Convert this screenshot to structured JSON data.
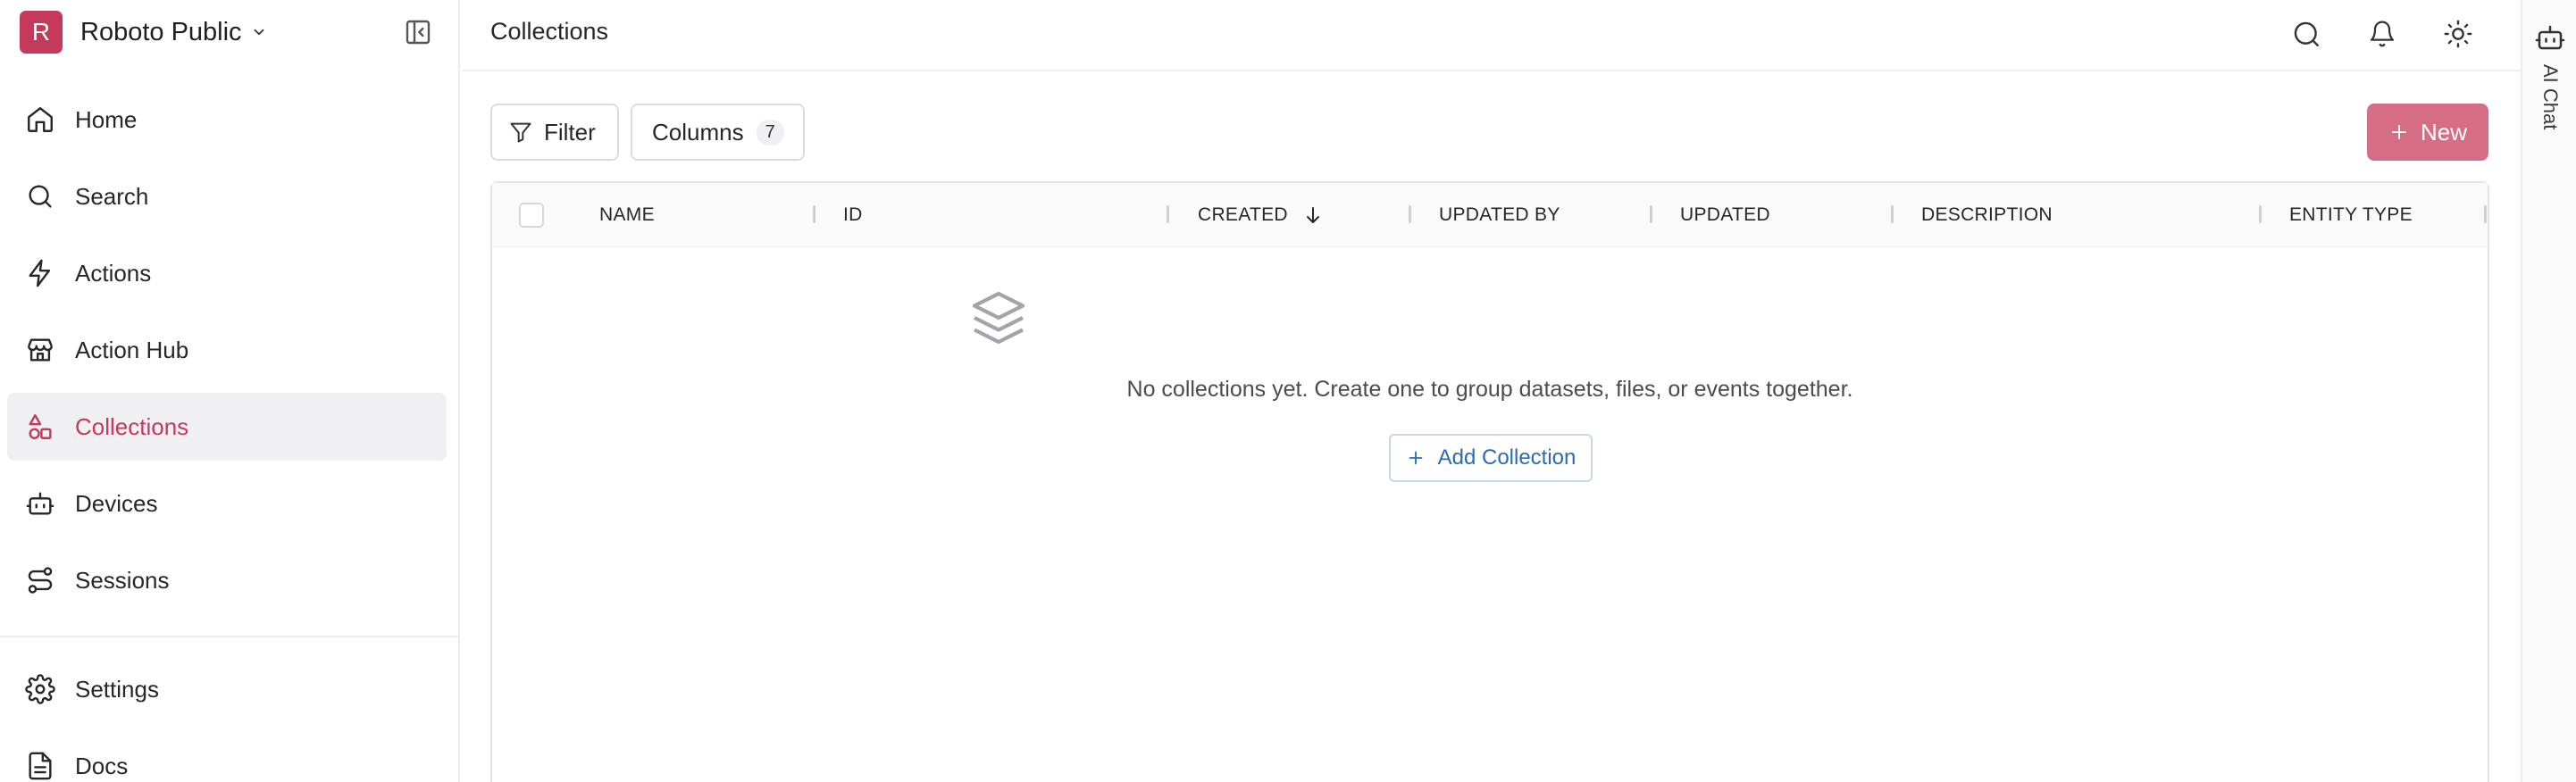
{
  "org": {
    "initial": "R",
    "name": "Roboto Public"
  },
  "nav": {
    "items": [
      {
        "label": "Home",
        "icon": "home-icon"
      },
      {
        "label": "Search",
        "icon": "search-icon"
      },
      {
        "label": "Actions",
        "icon": "lightning-icon"
      },
      {
        "label": "Action Hub",
        "icon": "store-icon"
      },
      {
        "label": "Collections",
        "icon": "shapes-icon",
        "active": true
      },
      {
        "label": "Devices",
        "icon": "robot-icon"
      },
      {
        "label": "Sessions",
        "icon": "route-icon"
      }
    ],
    "bottom": [
      {
        "label": "Settings",
        "icon": "gear-icon"
      },
      {
        "label": "Docs",
        "icon": "document-icon"
      }
    ]
  },
  "header": {
    "title": "Collections"
  },
  "rail": {
    "label": "AI Chat"
  },
  "toolbar": {
    "filter_label": "Filter",
    "columns_label": "Columns",
    "columns_count": "7",
    "new_label": "New"
  },
  "table": {
    "columns": [
      "NAME",
      "ID",
      "CREATED",
      "UPDATED BY",
      "UPDATED",
      "DESCRIPTION",
      "ENTITY TYPE"
    ],
    "sorted_column": "CREATED",
    "sort_direction": "descending"
  },
  "empty_state": {
    "message": "No collections yet. Create one to group datasets, files, or events together.",
    "button_label": "Add Collection"
  },
  "colors": {
    "brand": "#c4395c",
    "new_button": "#d66d86",
    "link_blue": "#2b6cb0"
  }
}
